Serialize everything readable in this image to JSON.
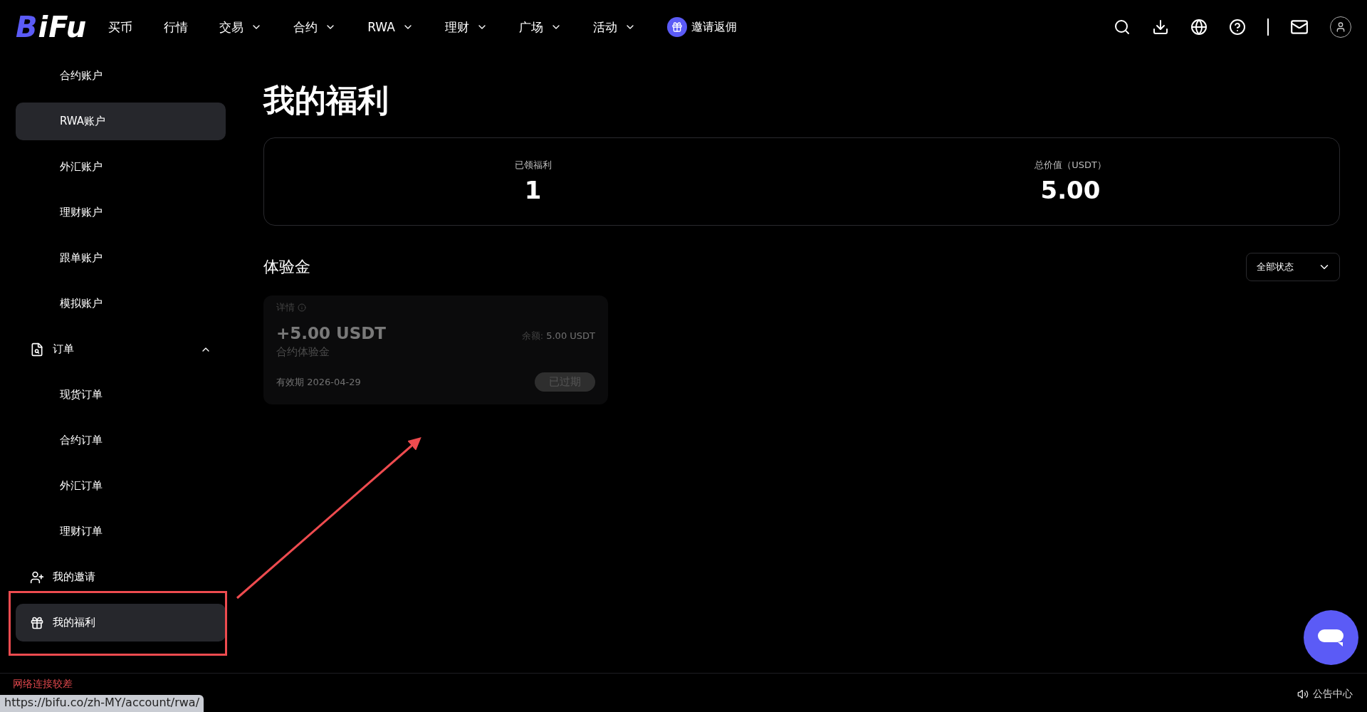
{
  "header": {
    "logo": "BiFu",
    "nav": [
      {
        "label": "买币",
        "dropdown": false
      },
      {
        "label": "行情",
        "dropdown": false
      },
      {
        "label": "交易",
        "dropdown": true
      },
      {
        "label": "合约",
        "dropdown": true
      },
      {
        "label": "RWA",
        "dropdown": true
      },
      {
        "label": "理财",
        "dropdown": true
      },
      {
        "label": "广场",
        "dropdown": true
      },
      {
        "label": "活动",
        "dropdown": true
      }
    ],
    "invite": "邀请返佣"
  },
  "sidebar": {
    "items": [
      {
        "kind": "link",
        "label": "合约账户",
        "selected": false
      },
      {
        "kind": "link",
        "label": "RWA账户",
        "selected": true
      },
      {
        "kind": "link",
        "label": "外汇账户",
        "selected": false
      },
      {
        "kind": "link",
        "label": "理财账户",
        "selected": false
      },
      {
        "kind": "link",
        "label": "跟单账户",
        "selected": false
      },
      {
        "kind": "link",
        "label": "模拟账户",
        "selected": false
      },
      {
        "kind": "orders",
        "label": "订单",
        "selected": false,
        "expanded": true,
        "children": [
          {
            "kind": "link",
            "label": "现货订单",
            "selected": false
          },
          {
            "kind": "link",
            "label": "合约订单",
            "selected": false
          },
          {
            "kind": "link",
            "label": "外汇订单",
            "selected": false
          },
          {
            "kind": "link",
            "label": "理财订单",
            "selected": false
          }
        ]
      },
      {
        "kind": "invite",
        "label": "我的邀请",
        "selected": false
      },
      {
        "kind": "gift",
        "label": "我的福利",
        "selected": true
      }
    ]
  },
  "main": {
    "title": "我的福利",
    "stats": [
      {
        "label": "已领福利",
        "value": "1"
      },
      {
        "label": "总价值（USDT）",
        "value": "5.00"
      }
    ],
    "section": {
      "title": "体验金",
      "filter": "全部状态"
    },
    "vouchers": [
      {
        "detail": "详情",
        "amount": "+5.00 USDT",
        "balance_label": "余额:",
        "balance": "5.00 USDT",
        "type": "合约体验金",
        "validity": "有效期 2026-04-29",
        "status": "已过期",
        "expired": true
      }
    ]
  },
  "footer": {
    "network_status": "网络连接较差",
    "notice": "公告中心",
    "url_tooltip": "https://bifu.co/zh-MY/account/rwa/"
  }
}
